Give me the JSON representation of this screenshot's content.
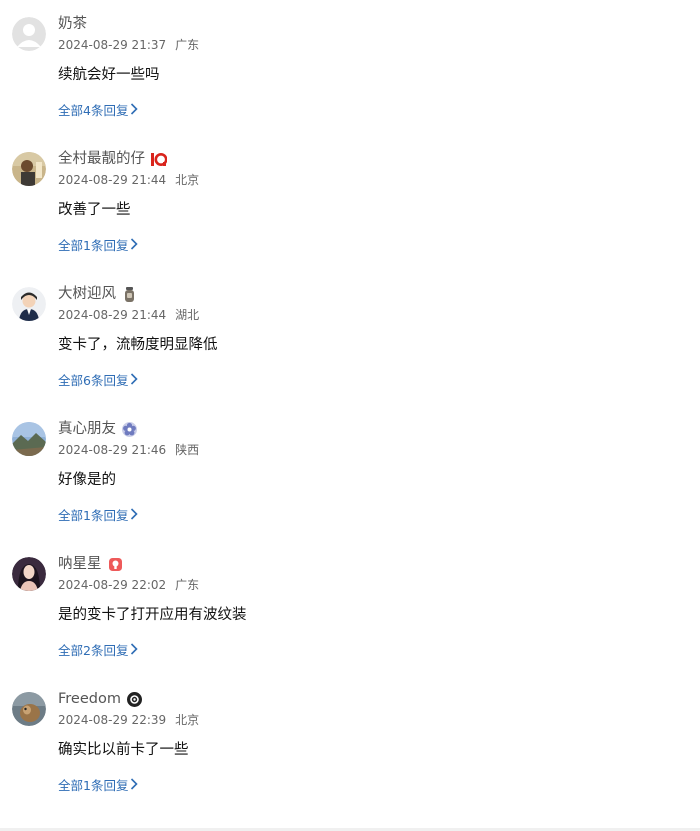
{
  "comments": [
    {
      "name": "奶茶",
      "badge": "",
      "time": "2024-08-29 21:37",
      "location": "广东",
      "text": "续航会好一些吗",
      "replies": "全部4条回复"
    },
    {
      "name": "全村最靓的仔",
      "badge": "rank-10-badge-icon",
      "time": "2024-08-29 21:44",
      "location": "北京",
      "text": "改善了一些",
      "replies": "全部1条回复"
    },
    {
      "name": "大树迎风",
      "badge": "bottle-badge-icon",
      "time": "2024-08-29 21:44",
      "location": "湖北",
      "text": "变卡了，流畅度明显降低",
      "replies": "全部6条回复"
    },
    {
      "name": "真心朋友",
      "badge": "flower-badge-icon",
      "time": "2024-08-29 21:46",
      "location": "陕西",
      "text": "好像是的",
      "replies": "全部1条回复"
    },
    {
      "name": "呐星星",
      "badge": "red-badge-icon",
      "time": "2024-08-29 22:02",
      "location": "广东",
      "text": "是的变卡了打开应用有波纹装",
      "replies": "全部2条回复"
    },
    {
      "name": "Freedom",
      "badge": "black-round-badge-icon",
      "time": "2024-08-29 22:39",
      "location": "北京",
      "text": "确实比以前卡了一些",
      "replies": "全部1条回复"
    }
  ],
  "colors": {
    "link": "#2f6db5",
    "name": "#555555",
    "meta": "#666666",
    "text": "#111111"
  }
}
